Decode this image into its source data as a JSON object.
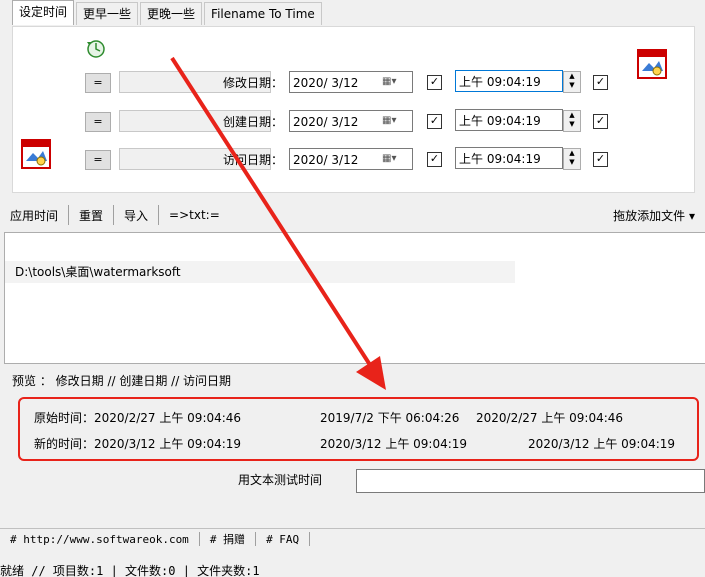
{
  "tabs": [
    {
      "label": "设定时间",
      "active": true
    },
    {
      "label": "更早一些",
      "active": false
    },
    {
      "label": "更晚一些",
      "active": false
    },
    {
      "label": "Filename To Time",
      "active": false
    }
  ],
  "date_rows": [
    {
      "eq_label": "=",
      "label": "修改日期：",
      "date": "2020/ 3/12",
      "time": "上午 09:04:19",
      "date_checked": true,
      "time_checked": true
    },
    {
      "eq_label": "=",
      "label": "创建日期：",
      "date": "2020/ 3/12",
      "time": "上午 09:04:19",
      "date_checked": true,
      "time_checked": true
    },
    {
      "eq_label": "=",
      "label": "访问日期：",
      "date": "2020/ 3/12",
      "time": "上午 09:04:19",
      "date_checked": true,
      "time_checked": true
    }
  ],
  "toolbar": {
    "apply": "应用时间",
    "reset": "重置",
    "import": "导入",
    "export_txt": "=>txt:=",
    "drag_add": "拖放添加文件 ▾"
  },
  "files": [
    "D:\\tools\\桌面\\watermarksoft"
  ],
  "preview": {
    "header": "预览 ：  修改日期   //   创建日期   //   访问日期",
    "original_label": "原始时间：",
    "original": [
      "2020/2/27 上午 09:04:46",
      "2019/7/2 下午 06:04:26",
      "2020/2/27 上午 09:04:46"
    ],
    "new_label": "新的时间：",
    "new": [
      "2020/3/12 上午 09:04:19",
      "2020/3/12 上午 09:04:19",
      "2020/3/12 上午 09:04:19"
    ]
  },
  "test_label": "用文本测试时间",
  "test_value": "",
  "links": [
    "# http://www.softwareok.com",
    "# 捐赠",
    "# FAQ"
  ],
  "status": "就绪 // 项目数:1 | 文件数:0 | 文件夹数:1",
  "colors": {
    "annotation": "#e8231a",
    "accent": "#0078d7"
  }
}
